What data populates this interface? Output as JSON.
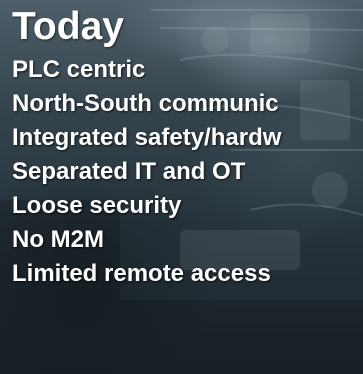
{
  "slide": {
    "title": "Today",
    "items": [
      "PLC centric",
      "North-South communic",
      "Integrated safety/hardw",
      "Separated IT and OT",
      "Loose security",
      "No M2M",
      "Limited remote access"
    ]
  },
  "colors": {
    "text": "#ffffff",
    "background": "#26333b"
  }
}
